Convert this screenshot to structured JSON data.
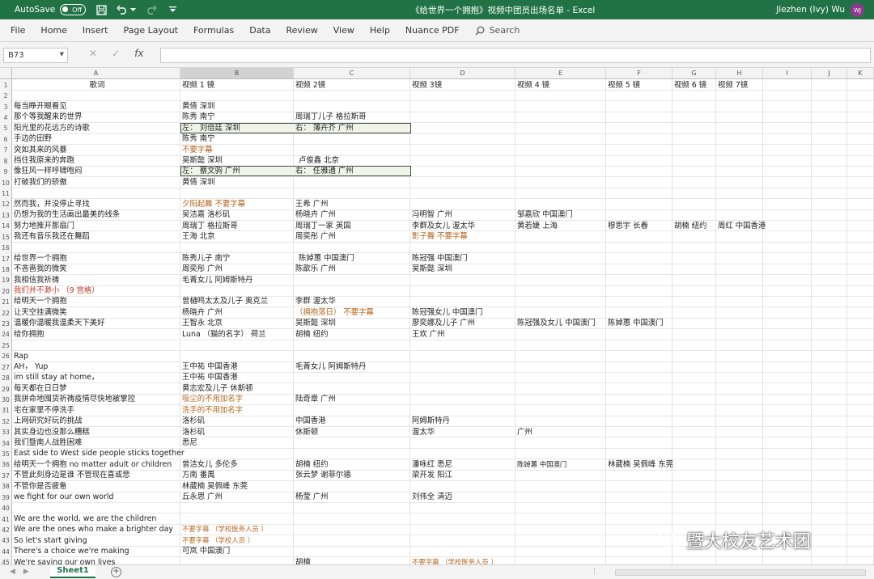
{
  "titlebar": {
    "autosave": "AutoSave",
    "toggle": "Off",
    "title": "《给世界一个拥抱》视频中团员出场名单  -  Excel",
    "user": "Jiezhen (Ivy) Wu",
    "initials": "WJ"
  },
  "ribbon": {
    "tabs": [
      "File",
      "Home",
      "Insert",
      "Page Layout",
      "Formulas",
      "Data",
      "Review",
      "View",
      "Help",
      "Nuance PDF"
    ],
    "search": "Search"
  },
  "formula_bar": {
    "name_box": "B73",
    "fx": "fx"
  },
  "columns": [
    "A",
    "B",
    "C",
    "D",
    "E",
    "F",
    "G",
    "H",
    "I",
    "J",
    "K"
  ],
  "rows": [
    "1",
    "2",
    "3",
    "4",
    "5",
    "6",
    "7",
    "8",
    "9",
    "10",
    "11",
    "12",
    "13",
    "14",
    "15",
    "16",
    "17",
    "18",
    "19",
    "20",
    "21",
    "22",
    "23",
    "24",
    "25",
    "26",
    "27",
    "28",
    "29",
    "30",
    "31",
    "32",
    "33",
    "34",
    "35",
    "36",
    "37",
    "38",
    "39",
    "40",
    "41",
    "42",
    "43",
    "44",
    "45"
  ],
  "header_row": {
    "A": "歌词",
    "B": "视频 1 镜",
    "C": "视频 2镜",
    "D": "视频 3镜",
    "E": "视频 4 镜",
    "F": "视频 5 镜",
    "G": "视频 6 镜",
    "H": "视频 7镜"
  },
  "cells": {
    "A3": "每当睁开眼看见",
    "B3": "黄倩 深圳",
    "A4": "那个等我醒来的世界",
    "B4": "陈秀 南宁",
    "C4": "周瑞丁儿子 格拉斯哥",
    "A5": "阳光里的花远方的诗歌",
    "B5": "左：  刘倍廷 深圳",
    "C5": "右：  薄卉芥 广州",
    "A6": "手边的田野",
    "B6": "陈秀 南宁",
    "A7": "突如其来的风暴",
    "B7": "不要字幕",
    "A8": "挡住我原来的奔跑",
    "B8": "吴斯懿 深圳",
    "C8": "卢俊鑫  北京",
    "A9": "像狂风一样呼啸咆闷",
    "B9": "左：  蔡文驹  广州",
    "C9": "右：  任雅通 广州",
    "A10": "打破我们的骄傲",
    "B10": "黄倩 深圳",
    "A12": "然而我，并没停止寻找",
    "B12": "夕阳起舞  不要字幕",
    "C12": "王希 广州",
    "A13": "仍想为我的生活画出最美的线条",
    "B13": "吴洁嘉 洛杉矶",
    "C13": "杨晓卉 广州",
    "D13": "冯明智 广州",
    "E13": "邹嘉欣 中国澳门",
    "A14": "努力地推开那扇门",
    "B14": "周瑞丁 格拉斯哥",
    "C14": "周瑞丁一家  英国",
    "D14": "李群及女儿 渥太华",
    "E14": "黄若婕 上海",
    "F14": "穆思宇 长春",
    "G14": "胡楠 纽约",
    "H14": "周红 中国香港",
    "A15": "我还有音乐我还在舞蹈",
    "B15": "王海 北京",
    "C15": "周奕彤 广州",
    "D15": "影子舞  不要字幕",
    "A17": "给世界一个拥抱",
    "B17": "陈秀儿子  南宁",
    "C17": "陈婥蕙  中国澳门",
    "D17": "陈冠强 中国澳门",
    "A18": "不吝啬我的微笑",
    "B18": "周奕彤 广州",
    "C18": "陈歆乐 广州",
    "D18": "吴斯懿 深圳",
    "A19": "我相信我祈祷",
    "B19": "毛菁女儿 阿姆斯特丹",
    "A20": "我们并不渺小  （9 宫格）",
    "A21": "给明天一个拥抱",
    "B21": "曾樋鸣太太及儿子  奥克兰",
    "C21": "李群  渥太华",
    "A22": "让天空挂满微笑",
    "B22": "杨晓卉 广州",
    "C22": "（拥抱落日）  不要字幕",
    "D22": "陈冠强女儿 中国澳门",
    "A23": "温暖你温暖我温柔天下美好",
    "B23": "王智永 北京",
    "C23": "吴斯懿  深圳",
    "D23": "廖奕娜及儿子  广州",
    "E23": "陈冠强及女儿 中国澳门",
    "F23": "陈婥蕙  中国澳门",
    "A24": "给你拥抱",
    "B24": "Luna  （猫的名字）  荷兰",
    "C24": "胡楠 纽约",
    "D24": "王欢 广州",
    "A26": "Rap",
    "A27": "AH，  Yup",
    "B27": "王中祐 中国香港",
    "C27": "毛菁女儿 阿姆斯特丹",
    "A28": " im still stay at home，",
    "B28": "王中祐 中国香港",
    "A29": " 每天都在日日梦",
    "B29": "黄志宏及儿子 休斯顿",
    "A30": "我拼命地囤货祈祷疫情尽快地被掌控",
    "B30": "吸尘的不用加名字",
    "C30": "陆奇章  广州",
    "A31": " 宅在家里不停洗手",
    "B31": "洗手的不用加名字",
    "A32": "上网研究好玩的挑战",
    "B32": "洛杉矶",
    "C32": "中国香港",
    "D32": "阿姆斯特丹",
    "A33": "其实身边也没那么糟糕",
    "B33": "洛杉矶",
    "C33": "休斯顿",
    "D33": "渥太华",
    "E33": "广州",
    "A34": "我们暨南人战胜困难",
    "B34": "悉尼",
    "A35": "East side to West side people sticks together",
    "A36": "给明天一个拥抱 no matter adult or children",
    "B36": "曾洁女儿 多伦多",
    "C36": "胡楠 纽约",
    "D36": "潘咏红 悉尼",
    "E36": "陈婥蕙  中国澳门",
    "F36": "林葳楠 吴佩峰 东莞",
    "A37": "不管此刻身边是谁 不管现在喜或悲",
    "B37": "方南 番禺",
    "C37": "张云梦  谢菲尔德",
    "D37": "梁开发 阳江",
    "A38": "不管你是否疲惫",
    "B38": "林葳楠 吴佩峰 东莞",
    "A39": "we fight for our own world",
    "B39": "丘永思 广州",
    "C39": "杨莹  广州",
    "D39": "刘伟全 清迈",
    "A41": "We are the world, we are the children",
    "A42": "We are the ones who make a brighter day",
    "B42": "不要字幕  （学校医务人员 ）",
    "A43": "So let's start giving",
    "B43": "不要字幕  （学校人员 ）",
    "A44": "There's a choice we're making",
    "B44": "可岚 中国澳门",
    "A45": "We're saving our own lives",
    "C45": "胡楠",
    "D45": "不要字幕  （学校医务人员 ）"
  },
  "sheet_tab": "Sheet1",
  "watermark": "暨大校友艺术团"
}
